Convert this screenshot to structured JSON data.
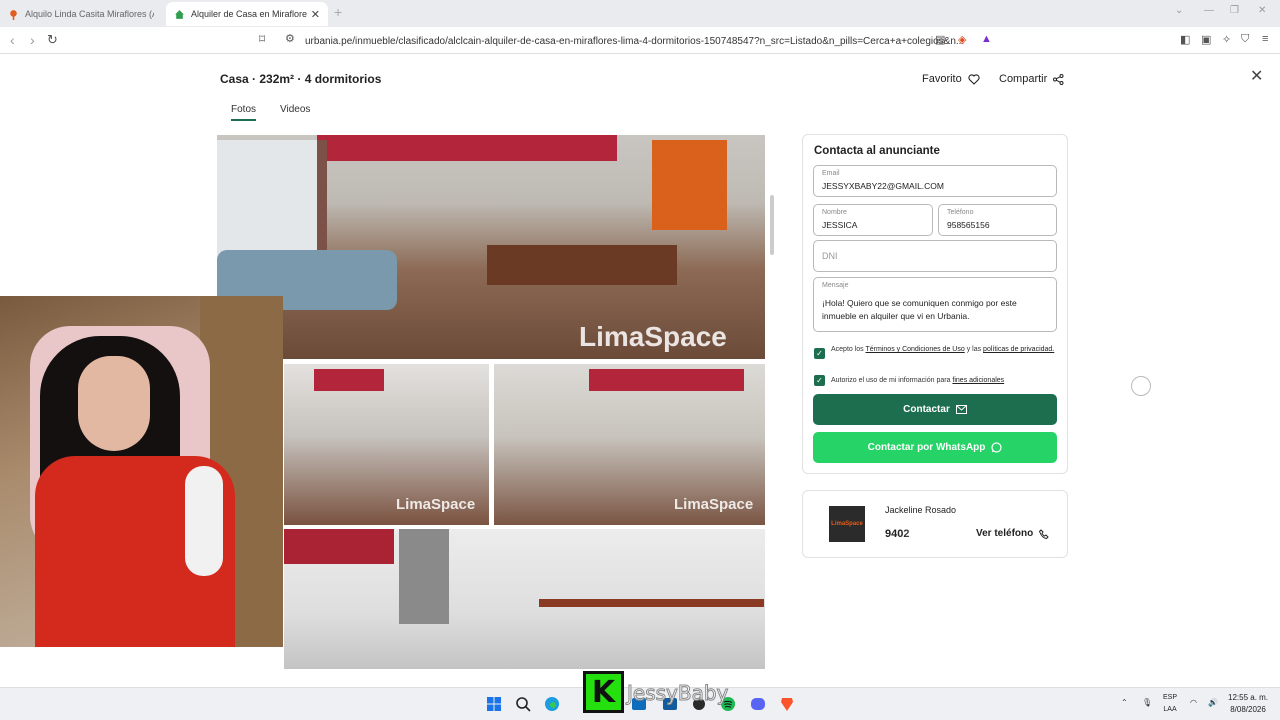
{
  "browser": {
    "tabs": [
      {
        "title": "Alquilo Linda Casita Miraflores (A. C...",
        "active": false
      },
      {
        "title": "Alquiler de Casa en Miraflores - ...",
        "active": true
      }
    ],
    "url": "urbania.pe/inmueble/clasificado/alclcain-alquiler-de-casa-en-miraflores-lima-4-dormitorios-150748547?n_src=Listado&n_pills=Cerca+a+colegios&n..."
  },
  "listing": {
    "title": "Casa · 232m² · 4 dormitorios",
    "favorite_label": "Favorito",
    "share_label": "Compartir",
    "media_tabs": [
      "Fotos",
      "Videos"
    ],
    "watermark": "LimaSpace"
  },
  "contact": {
    "heading": "Contacta al anunciante",
    "email_label": "Email",
    "email_value": "JESSYXBABY22@GMAIL.COM",
    "name_label": "Nombre",
    "name_value": "JESSICA",
    "phone_label": "Teléfono",
    "phone_value": "958565156",
    "dni_placeholder": "DNI",
    "message_label": "Mensaje",
    "message_value": "¡Hola! Quiero que se comuniquen conmigo por este inmueble en alquiler que vi en Urbania.",
    "terms_prefix": "Acepto los",
    "terms_link": "Términos y Condiciones de Uso",
    "terms_mid": "y las",
    "privacy_link": "políticas de privacidad.",
    "consent_prefix": "Autorizo el uso de mi información para",
    "consent_link": "fines adicionales",
    "contact_button": "Contactar",
    "whatsapp_button": "Contactar por WhatsApp"
  },
  "agent": {
    "logo_text": "LimaSpace",
    "name": "Jackeline Rosado",
    "phone_partial": "9402",
    "show_phone": "Ver teléfono"
  },
  "overlay": {
    "badge_letter": "K",
    "streamer_name": "JessyBaby"
  },
  "taskbar": {
    "lang_line1": "ESP",
    "lang_line2": "LAA",
    "time": "12:55 a. m.",
    "date": "8/08/2026"
  }
}
